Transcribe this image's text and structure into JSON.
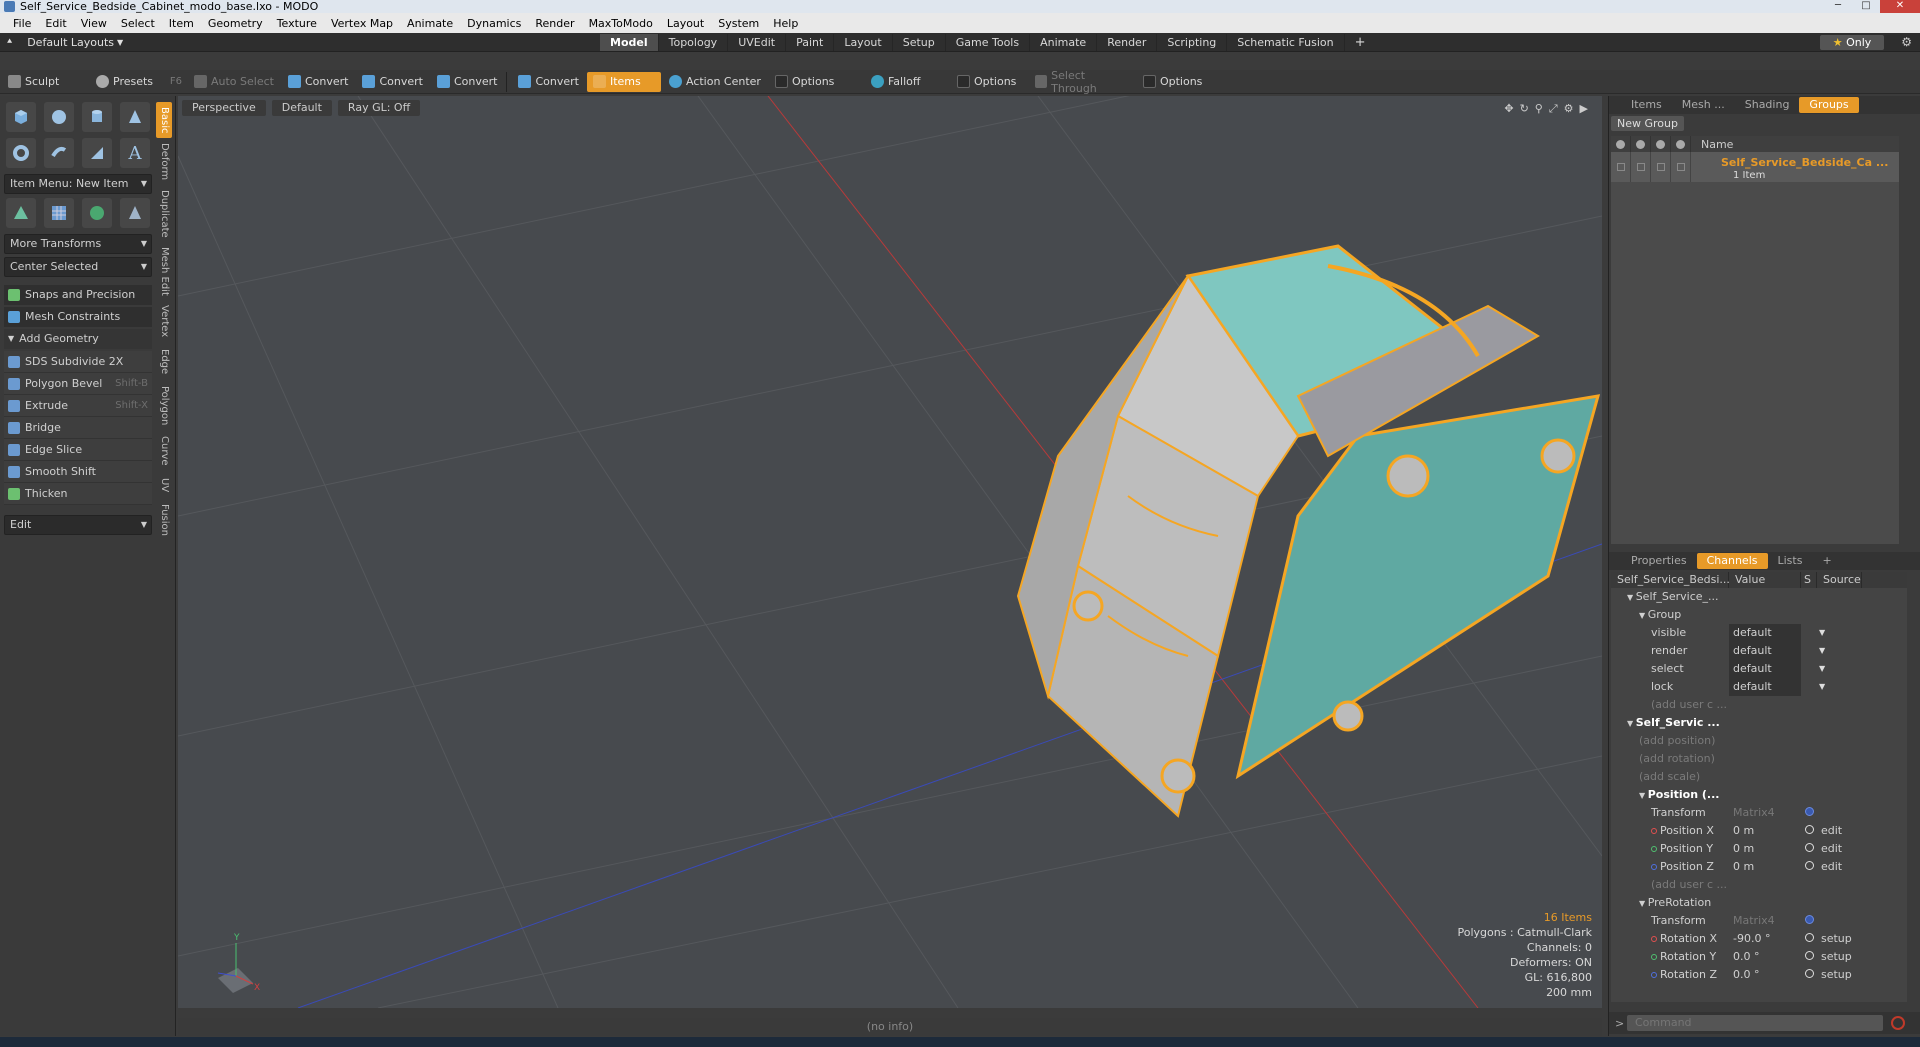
{
  "window": {
    "title": "Self_Service_Bedside_Cabinet_modo_base.lxo - MODO"
  },
  "menu": [
    "File",
    "Edit",
    "View",
    "Select",
    "Item",
    "Geometry",
    "Texture",
    "Vertex Map",
    "Animate",
    "Dynamics",
    "Render",
    "MaxToModo",
    "Layout",
    "System",
    "Help"
  ],
  "layoutbar": {
    "default_layouts": "Default Layouts",
    "tabs": [
      "Model",
      "Topology",
      "UVEdit",
      "Paint",
      "Layout",
      "Setup",
      "Game Tools",
      "Animate",
      "Render",
      "Scripting",
      "Schematic Fusion"
    ],
    "active_tab": "Model",
    "plus": "+",
    "only_label": "Only"
  },
  "toolbar": {
    "sculpt": "Sculpt",
    "presets": "Presets",
    "presets_key": "F6",
    "auto_select": "Auto Select",
    "convert": "Convert",
    "items": "Items",
    "action_center": "Action Center",
    "options": "Options",
    "falloff": "Falloff",
    "select_through": "Select Through"
  },
  "leftpanel": {
    "item_menu": "Item Menu: New Item",
    "more_transforms": "More Transforms",
    "center_selected": "Center Selected",
    "snaps": "Snaps and Precision",
    "mesh_constraints": "Mesh Constraints",
    "add_geometry": "Add Geometry",
    "tools": [
      {
        "label": "SDS Subdivide 2X",
        "shortcut": ""
      },
      {
        "label": "Polygon Bevel",
        "shortcut": "Shift-B"
      },
      {
        "label": "Extrude",
        "shortcut": "Shift-X"
      },
      {
        "label": "Bridge",
        "shortcut": ""
      },
      {
        "label": "Edge Slice",
        "shortcut": ""
      },
      {
        "label": "Smooth Shift",
        "shortcut": ""
      },
      {
        "label": "Thicken",
        "shortcut": ""
      }
    ],
    "edit": "Edit",
    "vtabs": [
      "Basic",
      "Deform",
      "Duplicate",
      "Mesh Edit",
      "Vertex",
      "Edge",
      "Polygon",
      "Curve",
      "UV",
      "Fusion"
    ]
  },
  "viewport": {
    "view": "Perspective",
    "shading": "Default",
    "raygl": "Ray GL: Off",
    "info": {
      "items": "16 Items",
      "polygons": "Polygons : Catmull-Clark",
      "channels": "Channels: 0",
      "deformers": "Deformers: ON",
      "gl": "GL: 616,800",
      "scale": "200 mm"
    },
    "status": "(no info)",
    "axes": {
      "y": "Y",
      "x": "X"
    }
  },
  "rightpanel": {
    "tabs": [
      "Items",
      "Mesh ...",
      "Shading",
      "Groups"
    ],
    "active_tab": "Groups",
    "new_group": "New Group",
    "name_header": "Name",
    "group_name": "Self_Service_Bedside_Ca ...",
    "group_sub": "1 Item",
    "ptabs": [
      "Properties",
      "Channels",
      "Lists"
    ],
    "active_ptab": "Channels",
    "plus": "+",
    "ch_header": {
      "name": "Self_Service_Bedsi...",
      "value": "Value",
      "s": "S",
      "source": "Source"
    },
    "channels": [
      {
        "name": "Self_Service_...",
        "value": "",
        "src": "",
        "kind": "head",
        "indent": 1
      },
      {
        "name": "Group",
        "value": "",
        "src": "",
        "kind": "head",
        "indent": 2
      },
      {
        "name": "visible",
        "value": "default",
        "src": "",
        "kind": "dd",
        "indent": 3
      },
      {
        "name": "render",
        "value": "default",
        "src": "",
        "kind": "dd",
        "indent": 3
      },
      {
        "name": "select",
        "value": "default",
        "src": "",
        "kind": "dd",
        "indent": 3
      },
      {
        "name": "lock",
        "value": "default",
        "src": "",
        "kind": "dd",
        "indent": 3
      },
      {
        "name": "(add user c ...",
        "value": "",
        "src": "",
        "kind": "dim",
        "indent": 3
      },
      {
        "name": "Self_Servic ...",
        "value": "",
        "src": "",
        "kind": "bold",
        "indent": 1
      },
      {
        "name": "(add position)",
        "value": "",
        "src": "",
        "kind": "dim",
        "indent": 2
      },
      {
        "name": "(add rotation)",
        "value": "",
        "src": "",
        "kind": "dim",
        "indent": 2
      },
      {
        "name": "(add scale)",
        "value": "",
        "src": "",
        "kind": "dim",
        "indent": 2
      },
      {
        "name": "Position (...",
        "value": "",
        "src": "",
        "kind": "bold",
        "indent": 2
      },
      {
        "name": "Transform",
        "value": "Matrix4",
        "src": "",
        "kind": "matrix",
        "indent": 3
      },
      {
        "name": "Position X",
        "value": "0 m",
        "src": "edit",
        "kind": "x",
        "indent": 3
      },
      {
        "name": "Position Y",
        "value": "0 m",
        "src": "edit",
        "kind": "y",
        "indent": 3
      },
      {
        "name": "Position Z",
        "value": "0 m",
        "src": "edit",
        "kind": "z",
        "indent": 3
      },
      {
        "name": "(add user c ...",
        "value": "",
        "src": "",
        "kind": "dim",
        "indent": 3
      },
      {
        "name": "PreRotation",
        "value": "",
        "src": "",
        "kind": "head",
        "indent": 2
      },
      {
        "name": "Transform",
        "value": "Matrix4",
        "src": "",
        "kind": "matrix",
        "indent": 3
      },
      {
        "name": "Rotation X",
        "value": "-90.0 °",
        "src": "setup",
        "kind": "x",
        "indent": 3
      },
      {
        "name": "Rotation Y",
        "value": "0.0 °",
        "src": "setup",
        "kind": "y",
        "indent": 3
      },
      {
        "name": "Rotation Z",
        "value": "0.0 °",
        "src": "setup",
        "kind": "z",
        "indent": 3
      }
    ],
    "command_placeholder": "Command"
  },
  "colors": {
    "accent": "#e79a28",
    "mesh_teal": "#7fc7c0",
    "wire": "#f5a623"
  }
}
